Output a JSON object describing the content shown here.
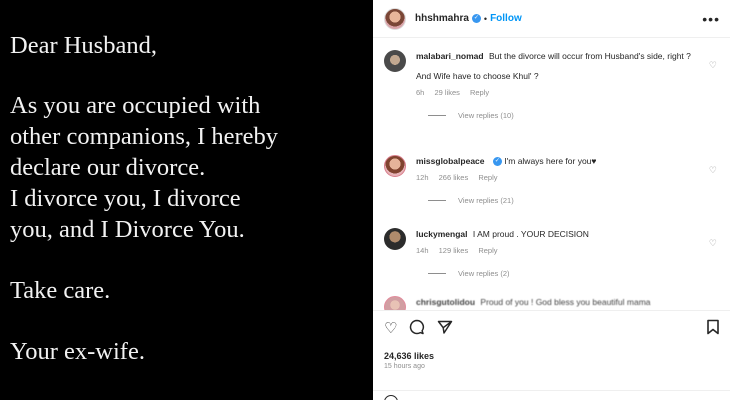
{
  "post_image": {
    "greeting": "Dear Husband,",
    "paragraph1": "As you are occupied with\nother companions, I hereby\ndeclare our divorce.\nI divorce you, I divorce\nyou, and I Divorce You.",
    "paragraph2": "Take care.",
    "closing": "Your ex-wife."
  },
  "header": {
    "username": "hhshmahra",
    "separator": "•",
    "follow_label": "Follow",
    "more_label": "•••"
  },
  "comments": [
    {
      "username": "malabari_nomad",
      "text": "But the divorce will occur from Husband's side, right ?",
      "text2": "And Wife have to choose Khul' ?",
      "age": "6h",
      "likes": "29 likes",
      "reply_label": "Reply",
      "view_replies": "View replies (10)"
    },
    {
      "username": "missglobalpeace",
      "text": "I'm always here for you♥",
      "age": "12h",
      "likes": "266 likes",
      "reply_label": "Reply",
      "view_replies": "View replies (21)"
    },
    {
      "username": "luckymengal",
      "text": "I AM proud . YOUR DECISION",
      "age": "14h",
      "likes": "129 likes",
      "reply_label": "Reply",
      "view_replies": "View replies (2)"
    },
    {
      "username": "chrisgutolidou",
      "text": "Proud of you ! God bless you beautiful mama"
    }
  ],
  "actions": {
    "like_icon": "heart-icon",
    "comment_icon": "comment-icon",
    "share_icon": "share-icon",
    "save_icon": "bookmark-icon",
    "likes_count": "24,636 likes",
    "posted_ago": "15 hours ago"
  },
  "colors": {
    "accent": "#0095f6",
    "verified": "#3897f0",
    "muted": "#8e8e8e"
  }
}
